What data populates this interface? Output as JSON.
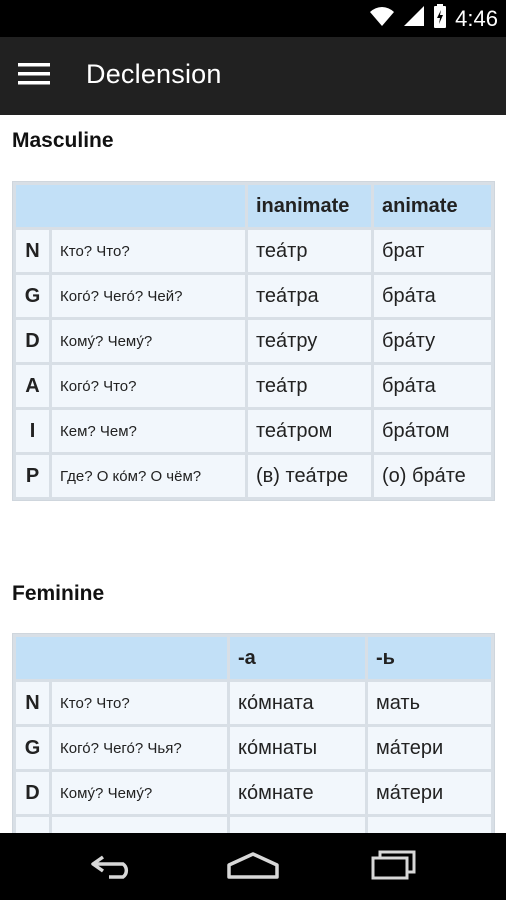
{
  "status": {
    "time": "4:46"
  },
  "appbar": {
    "title": "Declension"
  },
  "masculine": {
    "title": "Masculine",
    "columns": [
      "inanimate",
      "animate"
    ],
    "rows": [
      {
        "case": "N",
        "question": "Кто? Что?",
        "w1": "теа́тр",
        "w2": "брат"
      },
      {
        "case": "G",
        "question": "Кого́? Чего́? Чей?",
        "w1": "теа́тра",
        "w2": "бра́та"
      },
      {
        "case": "D",
        "question": "Кому́? Чему́?",
        "w1": "теа́тру",
        "w2": "бра́ту"
      },
      {
        "case": "A",
        "question": "Кого́? Что?",
        "w1": "теа́тр",
        "w2": "бра́та"
      },
      {
        "case": "I",
        "question": "Кем? Чем?",
        "w1": "теа́тром",
        "w2": "бра́том"
      },
      {
        "case": "P",
        "question": "Где? О ко́м? О чём?",
        "w1": "(в) теа́тре",
        "w2": "(о) бра́те"
      }
    ]
  },
  "feminine": {
    "title": "Feminine",
    "columns": [
      "-а",
      "-ь"
    ],
    "rows": [
      {
        "case": "N",
        "question": "Кто? Что?",
        "w1": "ко́мната",
        "w2": "мать"
      },
      {
        "case": "G",
        "question": "Кого́? Чего́? Чья?",
        "w1": "ко́мнаты",
        "w2": "ма́тери"
      },
      {
        "case": "D",
        "question": "Кому́? Чему́?",
        "w1": "ко́мнате",
        "w2": "ма́тери"
      }
    ]
  },
  "icons": {
    "menu": "hamburger-icon",
    "back": "back-icon",
    "home": "home-icon",
    "recents": "recents-icon"
  }
}
